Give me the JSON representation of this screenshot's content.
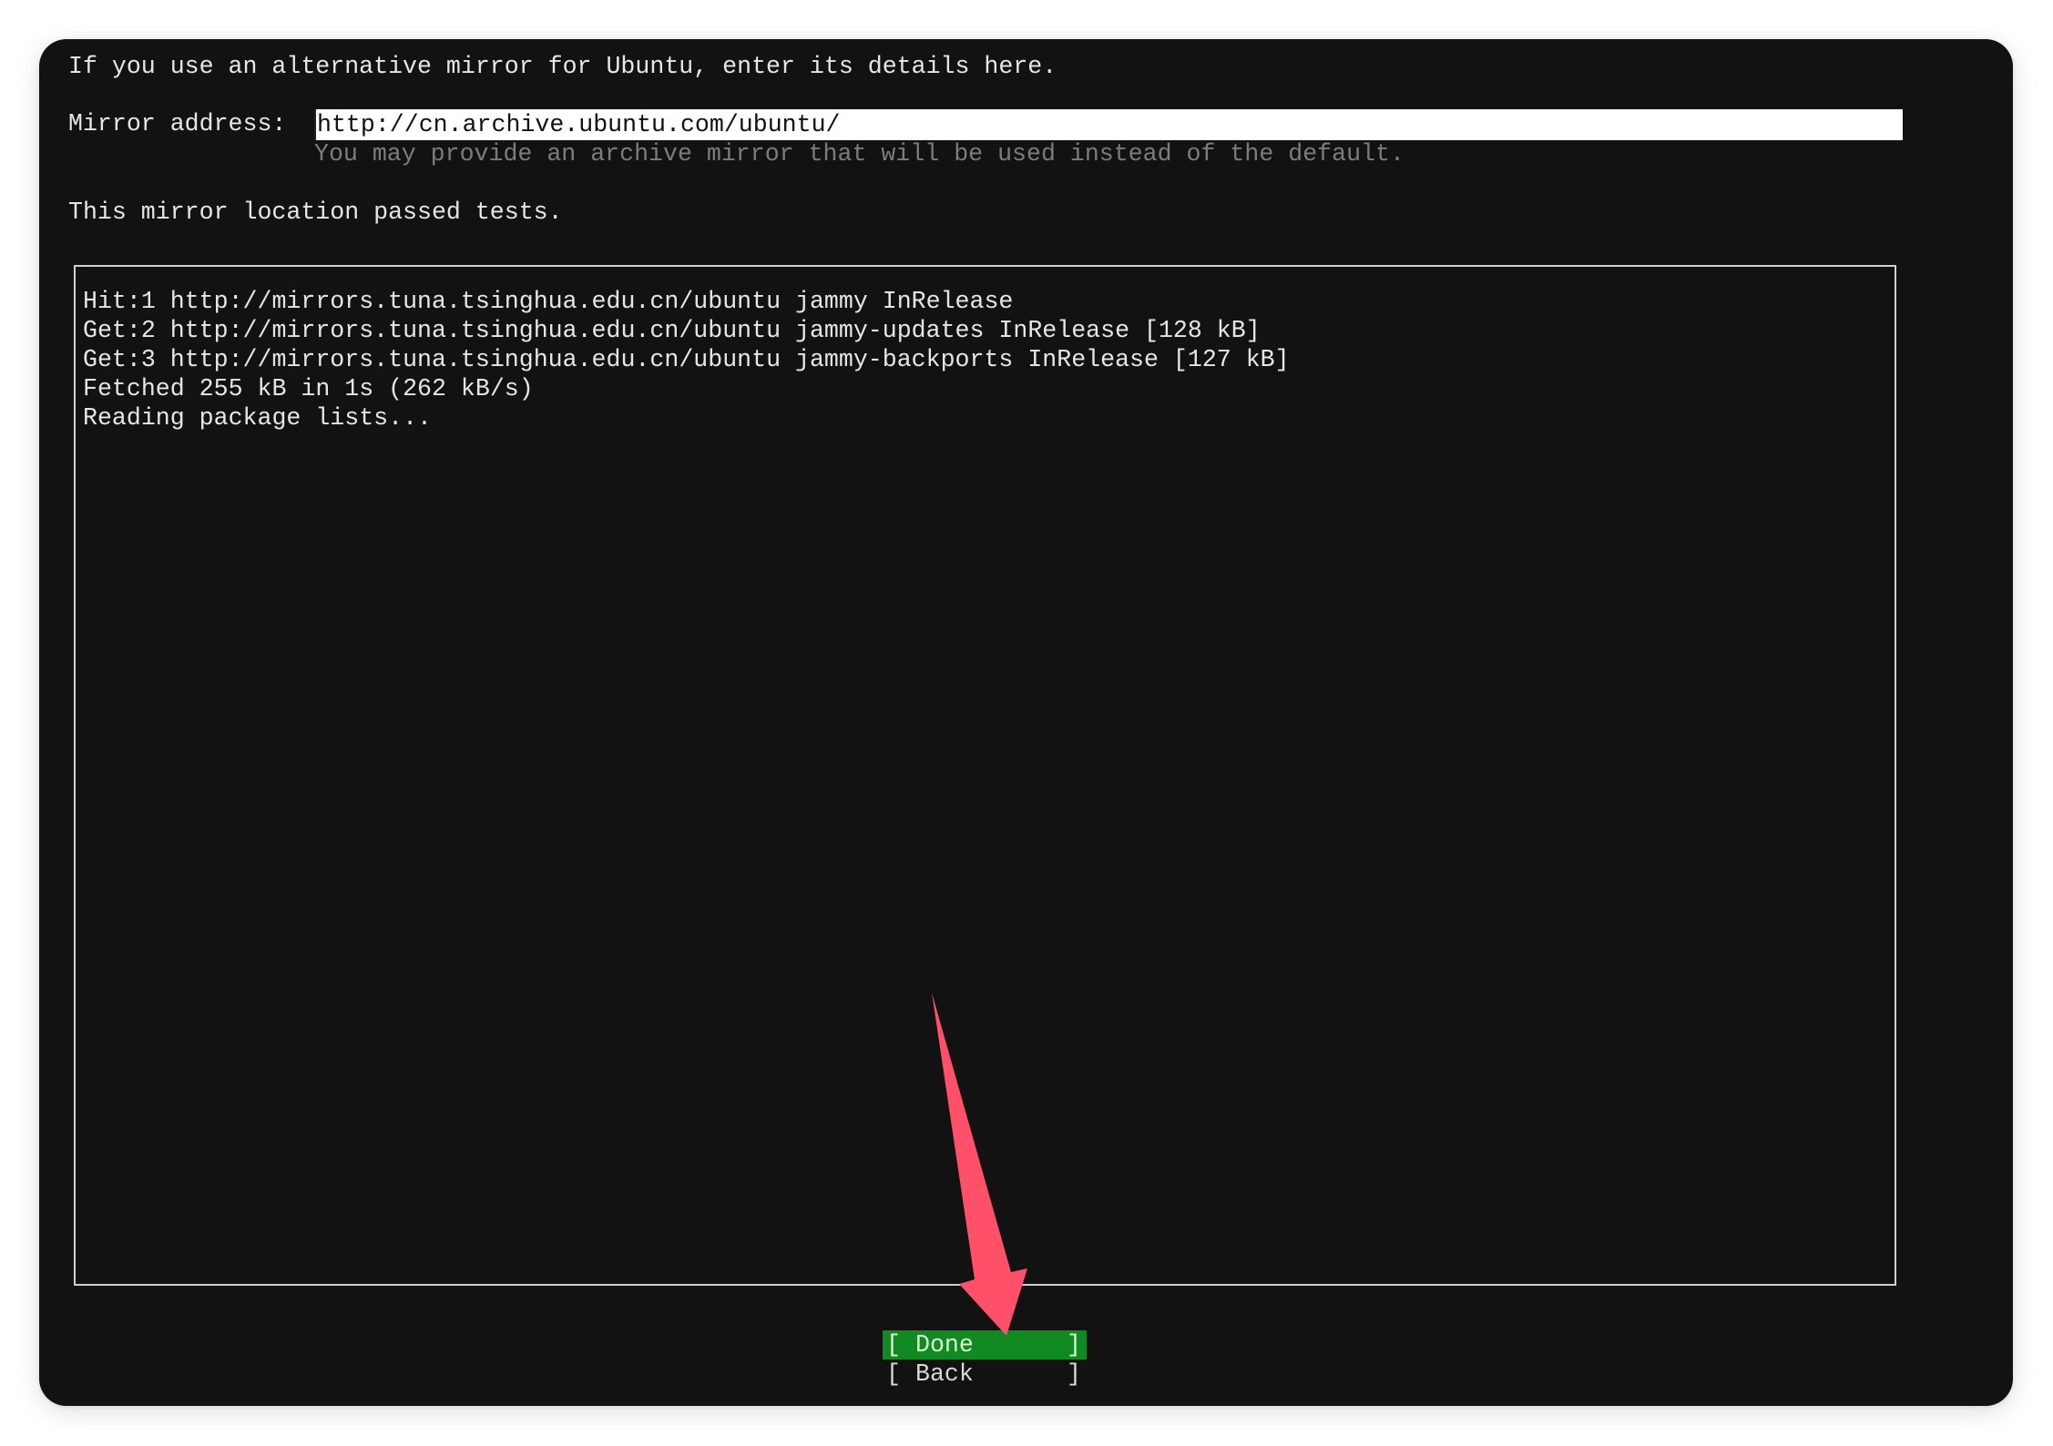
{
  "screen": {
    "intro_text": "If you use an alternative mirror for Ubuntu, enter its details here.",
    "mirror_field": {
      "label": "Mirror address:",
      "value": "http://cn.archive.ubuntu.com/ubuntu/",
      "hint": "You may provide an archive mirror that will be used instead of the default."
    },
    "status_text": "This mirror location passed tests.",
    "log": {
      "lines": [
        "Hit:1 http://mirrors.tuna.tsinghua.edu.cn/ubuntu jammy InRelease",
        "Get:2 http://mirrors.tuna.tsinghua.edu.cn/ubuntu jammy-updates InRelease [128 kB]",
        "Get:3 http://mirrors.tuna.tsinghua.edu.cn/ubuntu jammy-backports InRelease [127 kB]",
        "Fetched 255 kB in 1s (262 kB/s)",
        "Reading package lists..."
      ]
    },
    "buttons": {
      "done": {
        "label": "Done",
        "left_bracket": "[",
        "right_bracket": "]",
        "selected": true
      },
      "back": {
        "label": "Back",
        "left_bracket": "[",
        "right_bracket": "]",
        "selected": false
      }
    }
  },
  "annotation": {
    "arrow_icon": "arrow-pointing-to-done",
    "arrow_color": "#fe5068"
  },
  "colors": {
    "background": "#121212",
    "text": "#e6e6e6",
    "hint_text": "#7c7c7c",
    "selected_button": "#128a22",
    "log_border": "#cfcfcf"
  }
}
